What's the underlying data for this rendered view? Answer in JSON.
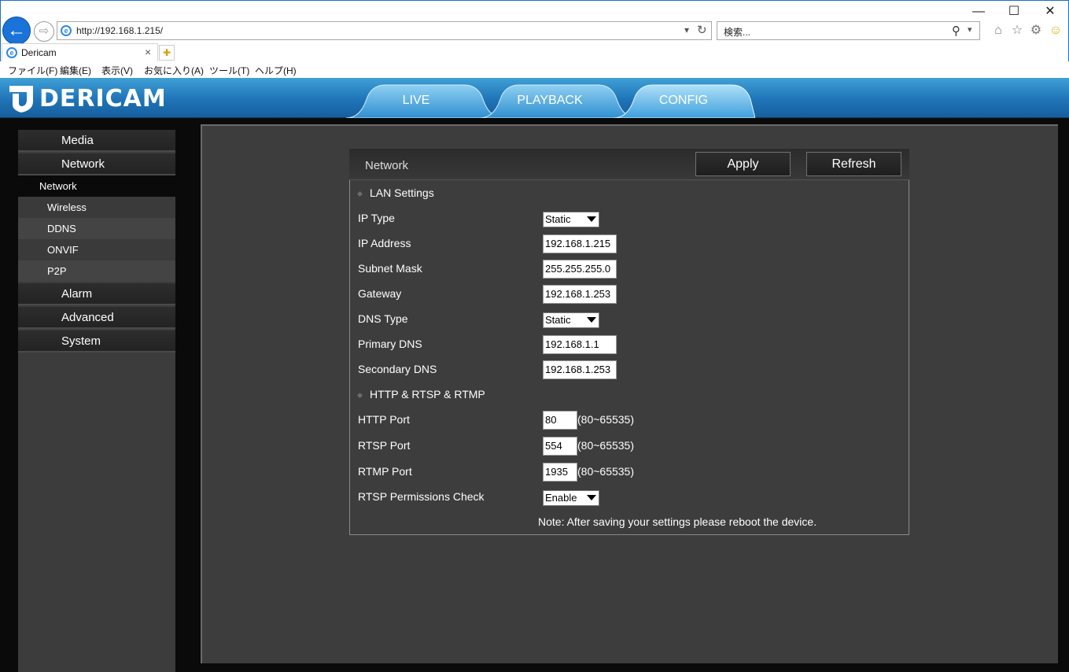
{
  "browser": {
    "address": "http://192.168.1.215/",
    "search_placeholder": "検索...",
    "tab_title": "Dericam",
    "menu": [
      "ファイル(F)",
      "編集(E)",
      "表示(V)",
      "お気に入り(A)",
      "ツール(T)",
      "ヘルプ(H)"
    ]
  },
  "app": {
    "logo": "DERICAM",
    "nav_tabs": [
      "LIVE",
      "PLAYBACK",
      "CONFIG"
    ],
    "active_tab": "CONFIG"
  },
  "sidebar": {
    "media": "Media",
    "network": "Network",
    "network_sub": [
      "Network",
      "Wireless",
      "DDNS",
      "ONVIF",
      "P2P"
    ],
    "alarm": "Alarm",
    "advanced": "Advanced",
    "system": "System"
  },
  "panel": {
    "title": "Network",
    "apply": "Apply",
    "refresh": "Refresh",
    "lan_section": "LAN Settings",
    "ip_type_label": "IP Type",
    "ip_type_value": "Static",
    "ip_address_label": "IP Address",
    "ip_address_value": "192.168.1.215",
    "subnet_label": "Subnet Mask",
    "subnet_value": "255.255.255.0",
    "gateway_label": "Gateway",
    "gateway_value": "192.168.1.253",
    "dns_type_label": "DNS Type",
    "dns_type_value": "Static",
    "primary_dns_label": "Primary DNS",
    "primary_dns_value": "192.168.1.1",
    "secondary_dns_label": "Secondary DNS",
    "secondary_dns_value": "192.168.1.253",
    "ports_section": "HTTP & RTSP & RTMP",
    "http_port_label": "HTTP Port",
    "http_port_value": "80",
    "rtsp_port_label": "RTSP Port",
    "rtsp_port_value": "554",
    "rtmp_port_label": "RTMP Port",
    "rtmp_port_value": "1935",
    "port_range": "(80~65535)",
    "rtsp_perm_label": "RTSP Permissions Check",
    "rtsp_perm_value": "Enable",
    "note": "Note: After saving your settings please reboot the device."
  },
  "colors": {
    "header_blue": "#1f74b8",
    "content_bg": "#3d3d3d",
    "sidebar_bg": "#3c3c3c"
  }
}
